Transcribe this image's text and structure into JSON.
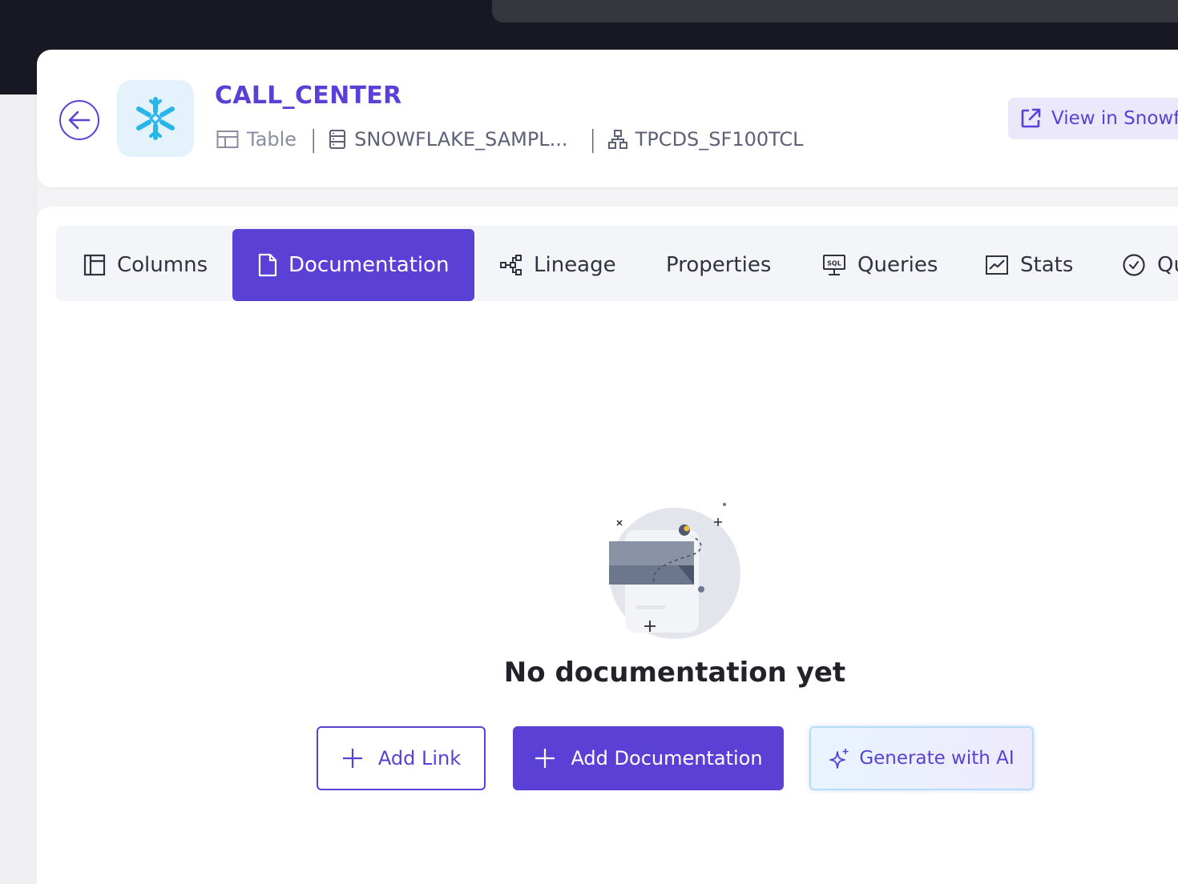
{
  "header": {
    "title": "CALL_CENTER",
    "type_label": "Table",
    "database": "SNOWFLAKE_SAMPL...",
    "schema": "TPCDS_SF100TCL",
    "view_button": "View in Snowf"
  },
  "tabs": [
    {
      "label": "Columns",
      "icon": "columns-icon"
    },
    {
      "label": "Documentation",
      "icon": "document-icon",
      "active": true
    },
    {
      "label": "Lineage",
      "icon": "lineage-icon"
    },
    {
      "label": "Properties"
    },
    {
      "label": "Queries",
      "icon": "sql-monitor-icon"
    },
    {
      "label": "Stats",
      "icon": "chart-icon"
    },
    {
      "label": "Qu",
      "icon": "check-circle-icon"
    }
  ],
  "empty_state": {
    "title": "No documentation yet",
    "add_link": "Add Link",
    "add_documentation": "Add Documentation",
    "generate_ai": "Generate with AI"
  },
  "colors": {
    "accent": "#5b40d6",
    "topbar": "#181824",
    "snowflake": "#29b5e8"
  }
}
